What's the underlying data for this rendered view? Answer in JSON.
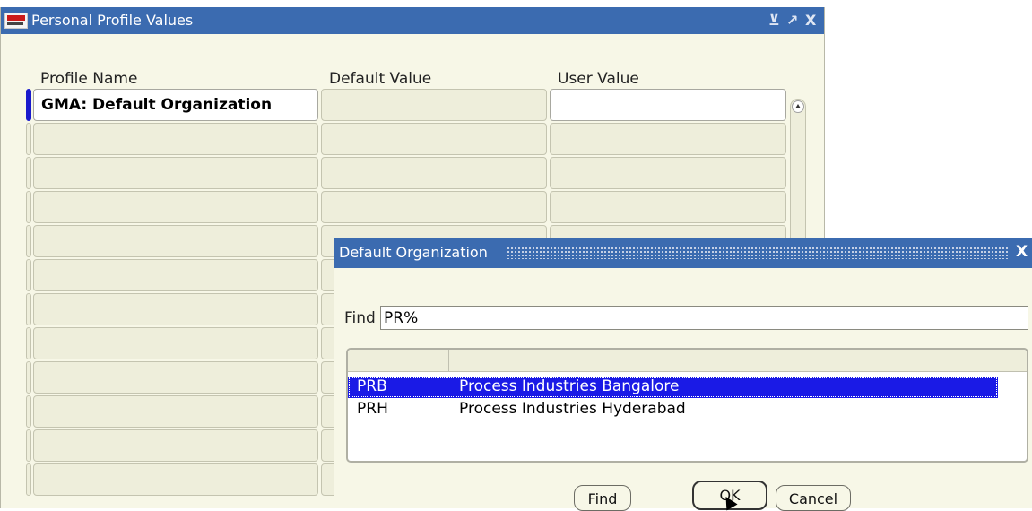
{
  "main_window": {
    "title": "Personal Profile Values",
    "controls": {
      "minimize": "⊻",
      "maximize": "↗",
      "close": "X"
    },
    "columns": {
      "profile_name": "Profile Name",
      "default_value": "Default Value",
      "user_value": "User Value"
    },
    "rows": [
      {
        "profile_name": "GMA: Default Organization",
        "default_value": "",
        "user_value": ""
      },
      {
        "profile_name": "",
        "default_value": "",
        "user_value": ""
      },
      {
        "profile_name": "",
        "default_value": "",
        "user_value": ""
      },
      {
        "profile_name": "",
        "default_value": "",
        "user_value": ""
      },
      {
        "profile_name": "",
        "default_value": "",
        "user_value": ""
      },
      {
        "profile_name": "",
        "default_value": "",
        "user_value": ""
      },
      {
        "profile_name": "",
        "default_value": "",
        "user_value": ""
      },
      {
        "profile_name": "",
        "default_value": "",
        "user_value": ""
      },
      {
        "profile_name": "",
        "default_value": "",
        "user_value": ""
      },
      {
        "profile_name": "",
        "default_value": "",
        "user_value": ""
      },
      {
        "profile_name": "",
        "default_value": "",
        "user_value": ""
      },
      {
        "profile_name": "",
        "default_value": "",
        "user_value": ""
      }
    ]
  },
  "dialog": {
    "title": "Default Organization",
    "close": "X",
    "find_label": "Find",
    "find_value": "PR%",
    "results": [
      {
        "code": "PRB",
        "description": "Process Industries Bangalore",
        "selected": true
      },
      {
        "code": "PRH",
        "description": "Process Industries Hyderabad",
        "selected": false
      }
    ],
    "buttons": {
      "find": "Find",
      "ok": "OK",
      "cancel": "Cancel"
    }
  },
  "colors": {
    "titlebar": "#3b6bb0",
    "background": "#f7f7e7",
    "selection": "#1a1ae6",
    "row_marker_active": "#1a1acc"
  }
}
